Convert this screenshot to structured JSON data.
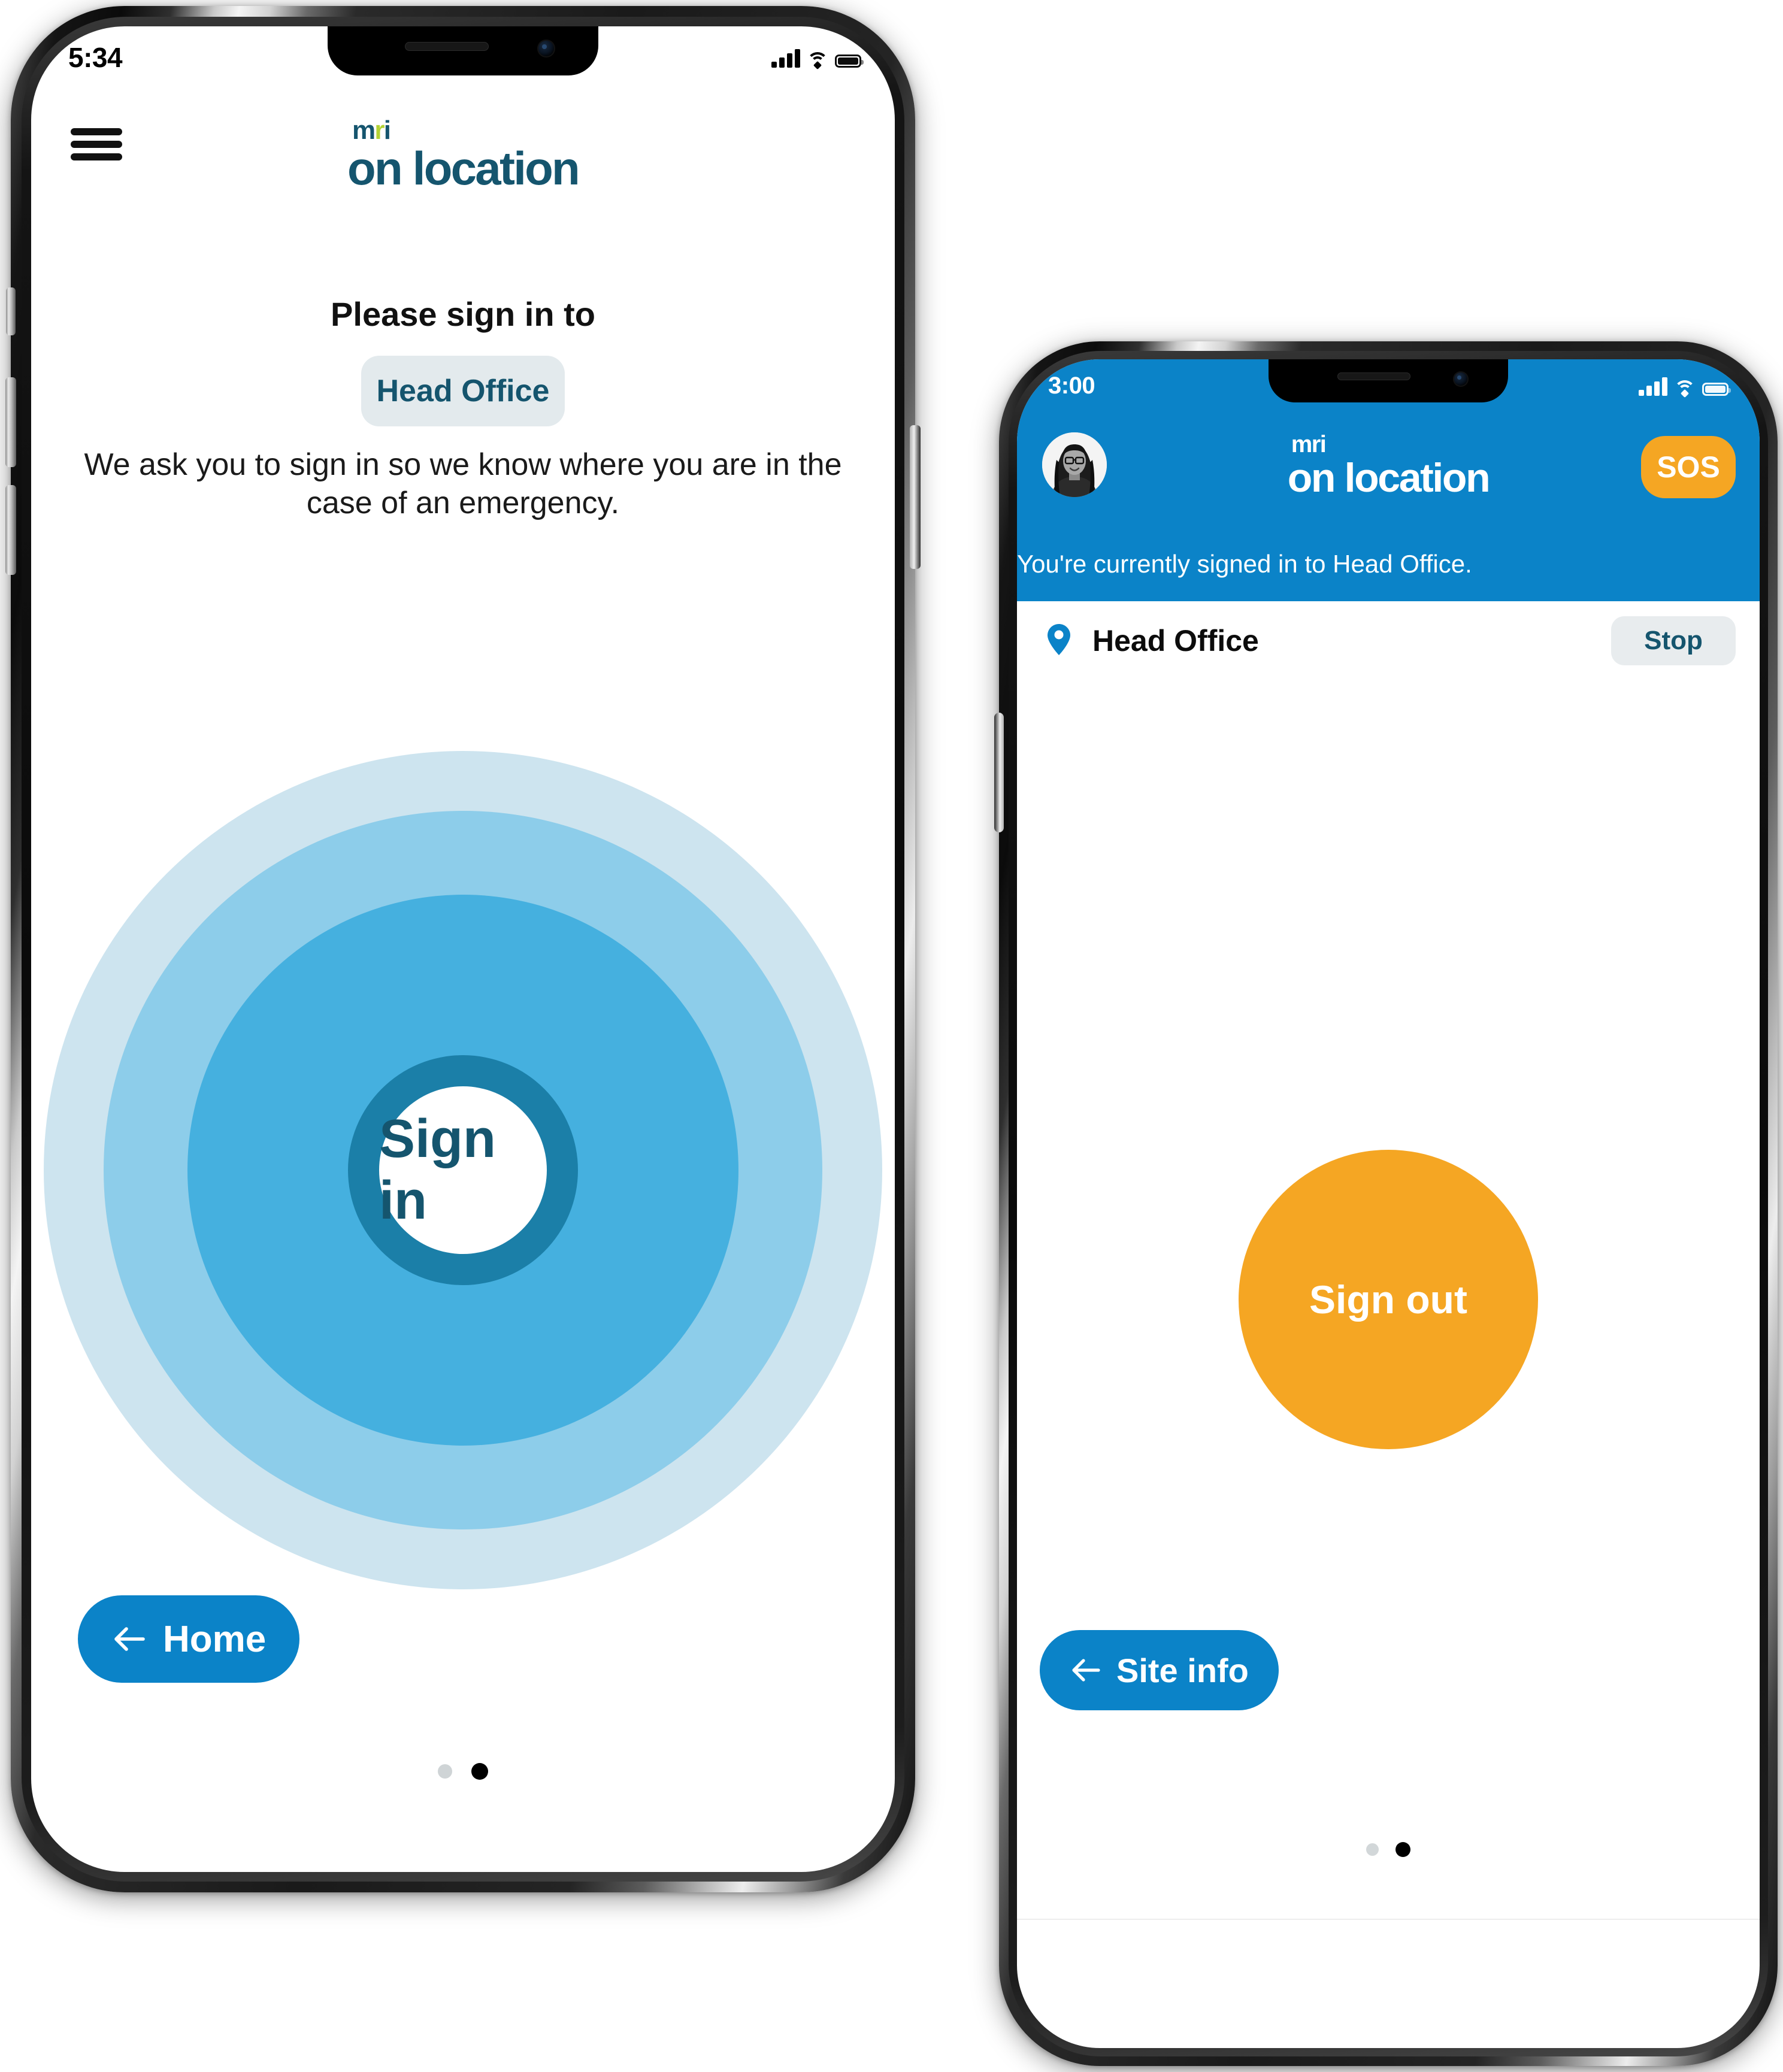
{
  "brand": {
    "logo_top": "mri",
    "logo_bottom": "on location",
    "teal": "#15556e",
    "green": "#b4d335",
    "blue": "#0b83c8",
    "orange": "#f5a623",
    "ring_lightest": "#cde4ef",
    "ring_light": "#8dcdea",
    "ring_mid": "#45b0df",
    "ring_dark": "#1b7fa8"
  },
  "phone1": {
    "status": {
      "time": "5:34",
      "signal_icon": "signal-bars-icon",
      "wifi_icon": "wifi-icon",
      "battery_icon": "battery-full-icon"
    },
    "header": {
      "menu_icon": "hamburger-menu-icon"
    },
    "prompt": "Please sign in to",
    "site_chip": "Head Office",
    "description": "We ask you to sign in so we know where you are in the case of an emergency.",
    "sign_in_label": "Sign in",
    "back_button": {
      "label": "Home",
      "icon": "arrow-left-icon"
    },
    "page_dots": {
      "count": 2,
      "active_index": 1
    }
  },
  "phone2": {
    "status": {
      "time": "3:00",
      "signal_icon": "signal-bars-icon",
      "wifi_icon": "wifi-icon",
      "battery_icon": "battery-full-icon"
    },
    "header": {
      "avatar_icon": "user-avatar-photo",
      "sos_label": "SOS"
    },
    "banner": "You're currently signed in to Head Office.",
    "site_row": {
      "pin_icon": "location-pin-icon",
      "site_name": "Head Office",
      "stop_label": "Stop"
    },
    "sign_out_label": "Sign out",
    "back_button": {
      "label": "Site info",
      "icon": "arrow-left-icon"
    },
    "page_dots": {
      "count": 2,
      "active_index": 1
    }
  }
}
